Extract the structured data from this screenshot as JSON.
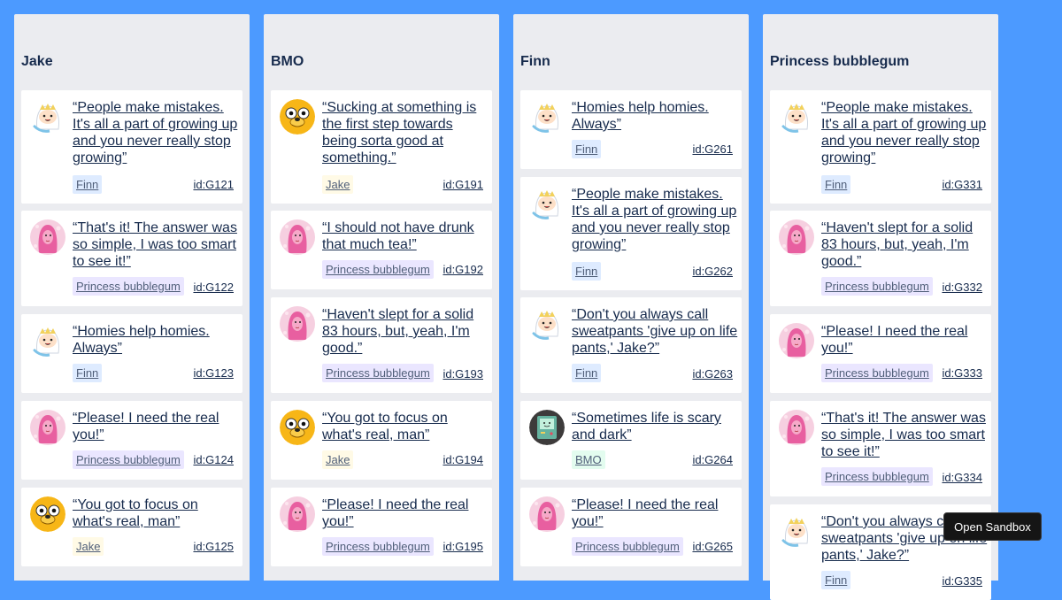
{
  "columns": [
    {
      "title": "Jake",
      "cards": [
        {
          "quote": "“People make mistakes. It's all a part of growing up and you never really stop growing”",
          "author": "Finn",
          "id": "id:G121"
        },
        {
          "quote": "“That's it! The answer was so simple, I was too smart to see it!”",
          "author": "Princess bubblegum",
          "id": "id:G122"
        },
        {
          "quote": "“Homies help homies. Always”",
          "author": "Finn",
          "id": "id:G123"
        },
        {
          "quote": "“Please! I need the real you!”",
          "author": "Princess bubblegum",
          "id": "id:G124"
        },
        {
          "quote": "“You got to focus on what's real, man”",
          "author": "Jake",
          "id": "id:G125"
        }
      ]
    },
    {
      "title": "BMO",
      "cards": [
        {
          "quote": "“Sucking at something is the first step towards being sorta good at something.”",
          "author": "Jake",
          "id": "id:G191"
        },
        {
          "quote": "“I should not have drunk that much tea!”",
          "author": "Princess bubblegum",
          "id": "id:G192"
        },
        {
          "quote": "“Haven't slept for a solid 83 hours, but, yeah, I'm good.”",
          "author": "Princess bubblegum",
          "id": "id:G193"
        },
        {
          "quote": "“You got to focus on what's real, man”",
          "author": "Jake",
          "id": "id:G194"
        },
        {
          "quote": "“Please! I need the real you!”",
          "author": "Princess bubblegum",
          "id": "id:G195"
        }
      ]
    },
    {
      "title": "Finn",
      "cards": [
        {
          "quote": "“Homies help homies. Always”",
          "author": "Finn",
          "id": "id:G261"
        },
        {
          "quote": "“People make mistakes. It's all a part of growing up and you never really stop growing”",
          "author": "Finn",
          "id": "id:G262"
        },
        {
          "quote": "“Don't you always call sweatpants 'give up on life pants,' Jake?”",
          "author": "Finn",
          "id": "id:G263"
        },
        {
          "quote": "“Sometimes life is scary and dark”",
          "author": "BMO",
          "id": "id:G264"
        },
        {
          "quote": "“Please! I need the real you!”",
          "author": "Princess bubblegum",
          "id": "id:G265"
        }
      ]
    },
    {
      "title": "Princess bubblegum",
      "cards": [
        {
          "quote": "“People make mistakes. It's all a part of growing up and you never really stop growing”",
          "author": "Finn",
          "id": "id:G331"
        },
        {
          "quote": "“Haven't slept for a solid 83 hours, but, yeah, I'm good.”",
          "author": "Princess bubblegum",
          "id": "id:G332"
        },
        {
          "quote": "“Please! I need the real you!”",
          "author": "Princess bubblegum",
          "id": "id:G333"
        },
        {
          "quote": "“That's it! The answer was so simple, I was too smart to see it!”",
          "author": "Princess bubblegum",
          "id": "id:G334"
        },
        {
          "quote": "“Don't you always call sweatpants 'give up on life pants,' Jake?”",
          "author": "Finn",
          "id": "id:G335"
        }
      ]
    }
  ],
  "sandbox_button": "Open Sandbox",
  "colors": {
    "background": "#4c9aff",
    "column": "#ebecf0",
    "card": "#ffffff",
    "finn_tag": "#deebff",
    "jake_tag": "#fffae6",
    "pb_tag": "#eae6ff",
    "bmo_tag": "#e3fcef"
  },
  "icons": {
    "Finn": "finn-avatar-icon",
    "Jake": "jake-avatar-icon",
    "Princess bubblegum": "princess-bubblegum-avatar-icon",
    "BMO": "bmo-avatar-icon"
  }
}
